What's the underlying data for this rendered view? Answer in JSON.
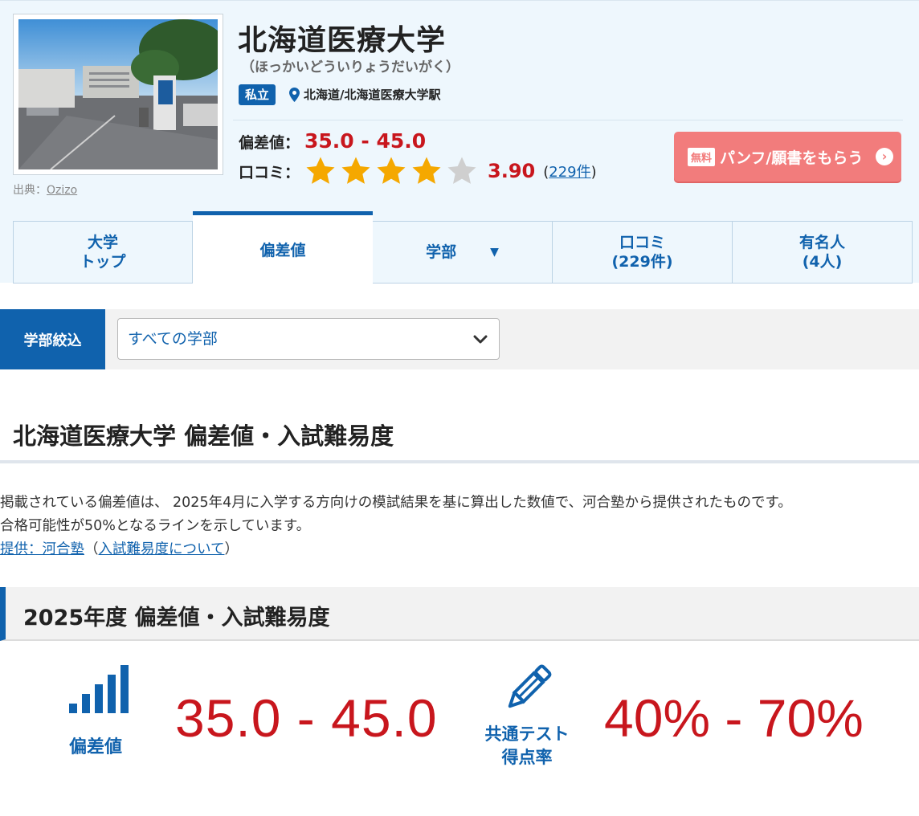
{
  "header": {
    "name": "北海道医療大学",
    "kana": "（ほっかいどういりょうだいがく）",
    "type_badge": "私立",
    "location": "北海道/北海道医療大学駅",
    "photo_credit_prefix": "出典：",
    "photo_credit_link": "Ozizo",
    "deviation_label": "偏差値：",
    "deviation_value": "35.0 - 45.0",
    "review_label": "口コミ：",
    "rating": "3.90",
    "rating_value": 3.9,
    "review_count_open": "(",
    "review_count_link": "229件",
    "review_count_close": ")",
    "pamphlet_free": "無料",
    "pamphlet_label": "パンフ/願書をもらう"
  },
  "tabs": [
    {
      "line1": "大学",
      "line2": "トップ"
    },
    {
      "line1": "偏差値",
      "line2": ""
    },
    {
      "line1": "学部",
      "line2": ""
    },
    {
      "line1": "口コミ",
      "line2": "(229件)"
    },
    {
      "line1": "有名人",
      "line2": "(4人)"
    }
  ],
  "filter": {
    "label": "学部絞込",
    "selected": "すべての学部"
  },
  "section": {
    "title": "北海道医療大学 偏差値・入試難易度",
    "desc_line1": "掲載されている偏差値は、 2025年4月に入学する方向けの模試結果を基に算出した数値で、河合塾から提供されたものです。",
    "desc_line2": "合格可能性が50%となるラインを示しています。",
    "provider_link": "提供：河合塾",
    "about_open": "（",
    "about_link": "入試難易度について",
    "about_close": "）"
  },
  "year_section": {
    "title": "2025年度 偏差値・入試難易度",
    "deviation_label": "偏差値",
    "deviation_value": "35.0 - 45.0",
    "score_label_line1": "共通テスト",
    "score_label_line2": "得点率",
    "score_value": "40% - 70%"
  },
  "colors": {
    "brand_blue": "#1062ad",
    "accent_red": "#c8161d",
    "button_pink": "#f27c7c",
    "star_gold": "#f5a800"
  }
}
